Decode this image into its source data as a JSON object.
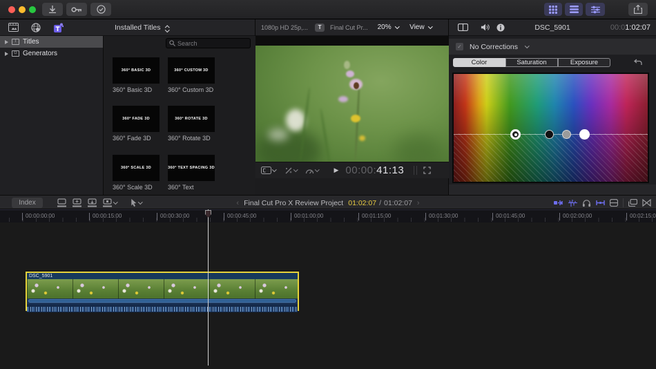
{
  "titlebar": {
    "window_controls": [
      "close",
      "minimize",
      "zoom"
    ],
    "left_icons": [
      "download-icon",
      "key-icon",
      "check-circle-icon"
    ],
    "right_icons": [
      "grid-view-icon",
      "list-view-icon",
      "adjust-sliders-icon",
      "share-icon"
    ]
  },
  "browser": {
    "media_icons": [
      "photos-media-icon",
      "effects-globe-icon",
      "titles-generators-icon"
    ],
    "header_dropdown": "Installed Titles",
    "sidebar": [
      {
        "label": "Titles"
      },
      {
        "label": "Generators"
      }
    ],
    "search": {
      "placeholder": "Search"
    },
    "titles": [
      {
        "thumb": "360° BASIC 3D",
        "label": "360° Basic 3D"
      },
      {
        "thumb": "360° CUSTOM 3D",
        "label": "360° Custom 3D"
      },
      {
        "thumb": "360° FADE 3D",
        "label": "360° Fade 3D"
      },
      {
        "thumb": "360° ROTATE 3D",
        "label": "360° Rotate 3D"
      },
      {
        "thumb": "360° SCALE 3D",
        "label": "360° Scale 3D"
      },
      {
        "thumb": "360° TEXT SPACING 3D",
        "label": "360° Text"
      }
    ]
  },
  "viewer": {
    "format_label": "1080p HD 25p,...",
    "titles_button": "T",
    "project_label": "Final Cut Pr...",
    "zoom_label": "20%",
    "view_label": "View",
    "timecode": {
      "dim": "00:00:",
      "bright": "41:13"
    }
  },
  "inspector": {
    "header_icons": [
      "video-clip-icon",
      "color-triangle-icon",
      "speaker-icon",
      "info-icon"
    ],
    "clip_name": "DSC_5901",
    "timecode": {
      "dim": "00:0",
      "bright": "1:02:07"
    },
    "corrections_label": "No Corrections",
    "tabs": [
      {
        "label": "Color",
        "active": true
      },
      {
        "label": "Saturation",
        "active": false
      },
      {
        "label": "Exposure",
        "active": false
      }
    ],
    "reset_icon": "reset-arrow-icon",
    "color_board_pucks": [
      "global-ring-puck",
      "shadows-puck",
      "midtones-puck",
      "highlights-puck"
    ]
  },
  "timeline": {
    "index_label": "Index",
    "edit_icons": [
      "connect-clip-icon",
      "insert-clip-icon",
      "append-clip-icon",
      "overwrite-clip-icon",
      "pointer-tool-icon"
    ],
    "nav_prev": "‹",
    "nav_next": "›",
    "project_name": "Final Cut Pro X Review Project",
    "current_time": "01:02:07",
    "separator": "/",
    "total_time": "01:02:07",
    "right_icons": [
      "clip-appearance-icon",
      "audio-waveform-icon",
      "headphones-icon",
      "trim-icon",
      "effects-icon",
      "stacked-panels-icon",
      "bowtie-icon"
    ],
    "ruler": [
      "00:00:00:00",
      "00:00:15:00",
      "00:00:30:00",
      "00:00:45:00",
      "00:01:00:00",
      "00:01:15:00",
      "00:01:30:00",
      "00:01:45:00",
      "00:02:00:00",
      "00:02:15:00"
    ],
    "clip": {
      "name": "DSC_5901"
    }
  },
  "colors": {
    "accent_purple": "#9a9aff",
    "timecode_yellow": "#e5c944",
    "selection_yellow": "#e6d23a",
    "clip_blue": "#17395c",
    "traffic_red": "#ff5f57",
    "traffic_yellow": "#febc2e",
    "traffic_green": "#28c840"
  }
}
